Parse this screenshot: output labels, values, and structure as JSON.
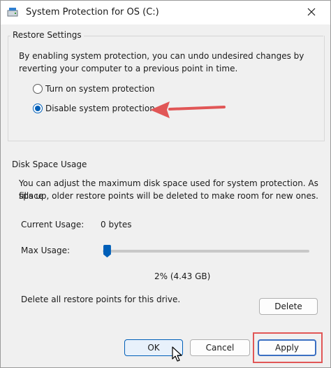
{
  "window": {
    "title": "System Protection for OS (C:)"
  },
  "restore_settings": {
    "group_label": "Restore Settings",
    "description_line1": "By enabling system protection, you can undo undesired changes by",
    "description_line2": "reverting your computer to a previous point in time.",
    "options": [
      {
        "label": "Turn on system protection",
        "selected": false
      },
      {
        "label": "Disable system protection",
        "selected": true
      }
    ]
  },
  "disk_space": {
    "group_label": "Disk Space Usage",
    "description_line1": "You can adjust the maximum disk space used for system protection. As space",
    "description_line2": "fills up, older restore points will be deleted to make room for new ones.",
    "current_usage_label": "Current Usage:",
    "current_usage_value": "0 bytes",
    "max_usage_label": "Max Usage:",
    "max_usage_fraction": 0.02,
    "max_usage_value": "2% (4.43 GB)",
    "delete_text": "Delete all restore points for this drive.",
    "delete_button": "Delete"
  },
  "footer": {
    "ok": "OK",
    "cancel": "Cancel",
    "apply": "Apply"
  },
  "colors": {
    "accent": "#005fb8",
    "annotation": "#e15656"
  },
  "icons": {
    "title": "drive-icon",
    "close": "close-icon",
    "pointer": "cursor-icon",
    "annotation": "red-arrow-icon"
  }
}
